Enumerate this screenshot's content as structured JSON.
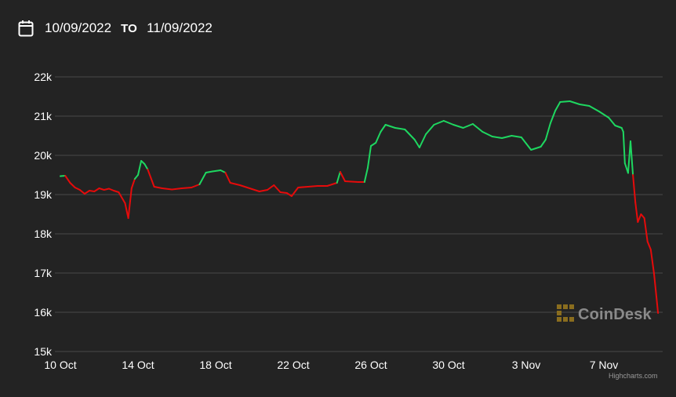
{
  "date_range": {
    "from": "10/09/2022",
    "separator": "TO",
    "to": "11/09/2022"
  },
  "icons": {
    "calendar": "calendar-icon",
    "brand_logo": "coindesk-logo-icon"
  },
  "watermark": "CoinDesk",
  "credits": "Highcharts.com",
  "colors": {
    "background": "#232323",
    "gridline": "#4a4a4a",
    "up": "#1ed760",
    "down": "#e50b0b",
    "watermark_icon": "#8a6d1e",
    "text": "#ffffff"
  },
  "chart_data": {
    "type": "line",
    "title": "",
    "xlabel": "",
    "ylabel": "",
    "y_ticks": [
      "15k",
      "16k",
      "17k",
      "18k",
      "19k",
      "20k",
      "21k",
      "22k"
    ],
    "ylim": [
      15000,
      22000
    ],
    "x_ticks": [
      "10 Oct",
      "14 Oct",
      "18 Oct",
      "22 Oct",
      "26 Oct",
      "30 Oct",
      "3 Nov",
      "7 Nov"
    ],
    "xlim": [
      "2022-10-10",
      "2022-11-09T19:00"
    ],
    "grid": true,
    "legend": false,
    "color_rule": "segments above the 2022-10-10 opening price are green, below are red",
    "baseline": 19470,
    "series": [
      {
        "points": [
          [
            "2022-10-10T00:00",
            19470
          ],
          [
            "2022-10-10T06:00",
            19480
          ],
          [
            "2022-10-10T12:00",
            19300
          ],
          [
            "2022-10-10T18:00",
            19180
          ],
          [
            "2022-10-11T00:00",
            19120
          ],
          [
            "2022-10-11T06:00",
            19020
          ],
          [
            "2022-10-11T12:00",
            19100
          ],
          [
            "2022-10-11T18:00",
            19080
          ],
          [
            "2022-10-12T00:00",
            19160
          ],
          [
            "2022-10-12T06:00",
            19120
          ],
          [
            "2022-10-12T12:00",
            19150
          ],
          [
            "2022-10-12T18:00",
            19100
          ],
          [
            "2022-10-13T00:00",
            19060
          ],
          [
            "2022-10-13T08:00",
            18780
          ],
          [
            "2022-10-13T12:00",
            18400
          ],
          [
            "2022-10-13T16:00",
            19160
          ],
          [
            "2022-10-13T20:00",
            19400
          ],
          [
            "2022-10-14T00:00",
            19500
          ],
          [
            "2022-10-14T04:00",
            19860
          ],
          [
            "2022-10-14T08:00",
            19780
          ],
          [
            "2022-10-14T12:00",
            19640
          ],
          [
            "2022-10-14T16:00",
            19420
          ],
          [
            "2022-10-14T20:00",
            19200
          ],
          [
            "2022-10-15T06:00",
            19160
          ],
          [
            "2022-10-15T18:00",
            19130
          ],
          [
            "2022-10-16T06:00",
            19160
          ],
          [
            "2022-10-16T18:00",
            19180
          ],
          [
            "2022-10-17T04:00",
            19260
          ],
          [
            "2022-10-17T12:00",
            19560
          ],
          [
            "2022-10-17T20:00",
            19590
          ],
          [
            "2022-10-18T06:00",
            19620
          ],
          [
            "2022-10-18T12:00",
            19560
          ],
          [
            "2022-10-18T18:00",
            19300
          ],
          [
            "2022-10-19T06:00",
            19240
          ],
          [
            "2022-10-19T18:00",
            19160
          ],
          [
            "2022-10-20T06:00",
            19080
          ],
          [
            "2022-10-20T16:00",
            19120
          ],
          [
            "2022-10-21T00:00",
            19240
          ],
          [
            "2022-10-21T08:00",
            19060
          ],
          [
            "2022-10-21T16:00",
            19040
          ],
          [
            "2022-10-21T22:00",
            18960
          ],
          [
            "2022-10-22T06:00",
            19180
          ],
          [
            "2022-10-22T18:00",
            19200
          ],
          [
            "2022-10-23T06:00",
            19220
          ],
          [
            "2022-10-23T18:00",
            19220
          ],
          [
            "2022-10-24T06:00",
            19300
          ],
          [
            "2022-10-24T10:00",
            19580
          ],
          [
            "2022-10-24T16:00",
            19340
          ],
          [
            "2022-10-25T00:00",
            19330
          ],
          [
            "2022-10-25T08:00",
            19320
          ],
          [
            "2022-10-25T16:00",
            19320
          ],
          [
            "2022-10-25T20:00",
            19680
          ],
          [
            "2022-10-26T00:00",
            20240
          ],
          [
            "2022-10-26T06:00",
            20320
          ],
          [
            "2022-10-26T12:00",
            20600
          ],
          [
            "2022-10-26T18:00",
            20780
          ],
          [
            "2022-10-27T06:00",
            20700
          ],
          [
            "2022-10-27T18:00",
            20660
          ],
          [
            "2022-10-28T06:00",
            20400
          ],
          [
            "2022-10-28T12:00",
            20200
          ],
          [
            "2022-10-28T20:00",
            20540
          ],
          [
            "2022-10-29T06:00",
            20780
          ],
          [
            "2022-10-29T18:00",
            20880
          ],
          [
            "2022-10-30T06:00",
            20780
          ],
          [
            "2022-10-30T18:00",
            20700
          ],
          [
            "2022-10-31T06:00",
            20800
          ],
          [
            "2022-10-31T18:00",
            20600
          ],
          [
            "2022-11-01T06:00",
            20480
          ],
          [
            "2022-11-01T18:00",
            20440
          ],
          [
            "2022-11-02T06:00",
            20500
          ],
          [
            "2022-11-02T18:00",
            20460
          ],
          [
            "2022-11-03T00:00",
            20300
          ],
          [
            "2022-11-03T06:00",
            20140
          ],
          [
            "2022-11-03T18:00",
            20220
          ],
          [
            "2022-11-04T00:00",
            20400
          ],
          [
            "2022-11-04T06:00",
            20820
          ],
          [
            "2022-11-04T12:00",
            21140
          ],
          [
            "2022-11-04T18:00",
            21360
          ],
          [
            "2022-11-05T06:00",
            21380
          ],
          [
            "2022-11-05T18:00",
            21300
          ],
          [
            "2022-11-06T06:00",
            21260
          ],
          [
            "2022-11-06T18:00",
            21120
          ],
          [
            "2022-11-07T06:00",
            20960
          ],
          [
            "2022-11-07T14:00",
            20760
          ],
          [
            "2022-11-07T22:00",
            20700
          ],
          [
            "2022-11-08T00:00",
            20600
          ],
          [
            "2022-11-08T02:00",
            19800
          ],
          [
            "2022-11-08T06:00",
            19550
          ],
          [
            "2022-11-08T09:00",
            20360
          ],
          [
            "2022-11-08T12:00",
            19500
          ],
          [
            "2022-11-08T15:00",
            18800
          ],
          [
            "2022-11-08T18:00",
            18300
          ],
          [
            "2022-11-08T22:00",
            18500
          ],
          [
            "2022-11-09T02:00",
            18400
          ],
          [
            "2022-11-09T06:00",
            17800
          ],
          [
            "2022-11-09T10:00",
            17600
          ],
          [
            "2022-11-09T14:00",
            17000
          ],
          [
            "2022-11-09T17:00",
            16400
          ],
          [
            "2022-11-09T19:00",
            15980
          ]
        ]
      }
    ]
  }
}
